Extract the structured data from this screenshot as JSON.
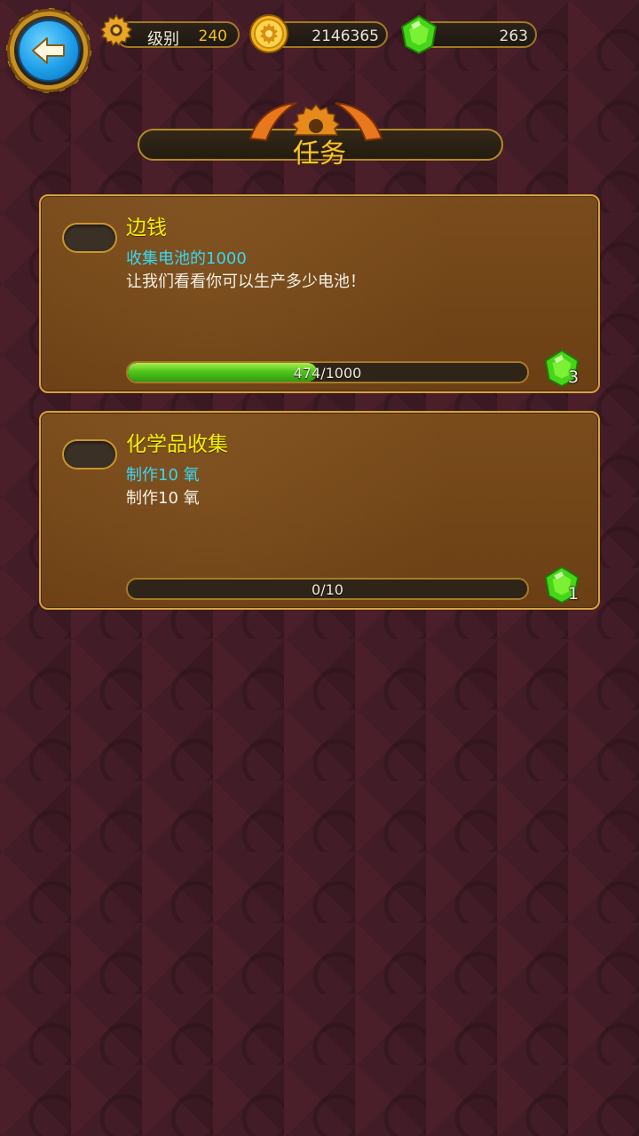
{
  "header": {
    "back_icon": "left-arrow-icon",
    "level_label": "级别",
    "level_value": "240",
    "coins_value": "2146365",
    "gems_value": "263"
  },
  "page": {
    "title": "任务"
  },
  "quests": [
    {
      "title": "边钱",
      "goal": "收集电池的1000",
      "description": "让我们看看你可以生产多少电池！",
      "progress_text": "474/1000",
      "progress_fraction": 0.474,
      "reward_count": "3",
      "reward_icon": "green-gem-icon"
    },
    {
      "title": "化学品收集",
      "goal": "制作10  氧",
      "description": "制作10  氧",
      "progress_text": "0/10",
      "progress_fraction": 0,
      "reward_count": "1",
      "reward_icon": "green-gem-icon"
    }
  ],
  "colors": {
    "background": "#4a1f2a",
    "card": "#6b3f14",
    "card_border": "#d5a43a",
    "title_yellow": "#f4f000",
    "goal_cyan": "#39d7f2",
    "progress_green": "#52c51b"
  }
}
